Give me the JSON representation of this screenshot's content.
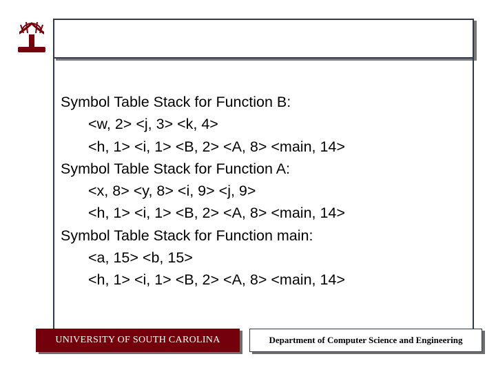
{
  "logo": {
    "name": "usc-logo"
  },
  "body": {
    "heading_b": "Symbol Table Stack for Function B:",
    "b_line1": "<w, 2> <j, 3> <k, 4>",
    "b_line2": "<h, 1> <i, 1> <B, 2> <A, 8> <main, 14>",
    "heading_a": "Symbol Table Stack for Function A:",
    "a_line1": "<x, 8> <y, 8> <i, 9> <j, 9>",
    "a_line2": "<h, 1> <i, 1> <B, 2> <A, 8> <main, 14>",
    "heading_main": "Symbol Table Stack for Function main:",
    "main_line1": "<a, 15> <b, 15>",
    "main_line2": "<h, 1> <i, 1> <B, 2> <A, 8> <main, 14>"
  },
  "footer": {
    "left": "UNIVERSITY OF SOUTH CAROLINA",
    "right": "Department of Computer Science and Engineering"
  }
}
